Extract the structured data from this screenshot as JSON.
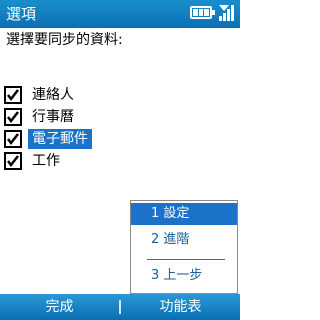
{
  "window": {
    "title": "選項"
  },
  "status": {
    "battery_icon": "battery-icon",
    "signal_icon": "signal-strength-icon"
  },
  "prompt": "選擇要同步的資料:",
  "options": [
    {
      "label": "連絡人",
      "checked": true
    },
    {
      "label": "行事曆",
      "checked": true
    },
    {
      "label": "電子郵件",
      "checked": true,
      "selected": true
    },
    {
      "label": "工作",
      "checked": true
    }
  ],
  "menu": {
    "items": [
      {
        "label": "1 設定",
        "selected": true
      },
      {
        "label": "2 進階",
        "selected": false
      },
      {
        "label": "3 上一步",
        "selected": false
      }
    ]
  },
  "softkeys": {
    "left": "完成",
    "right": "功能表"
  },
  "colors": {
    "title_bar": "#0a6fb4",
    "highlight": "#1a73c8",
    "menu_text": "#1a5f9e"
  }
}
